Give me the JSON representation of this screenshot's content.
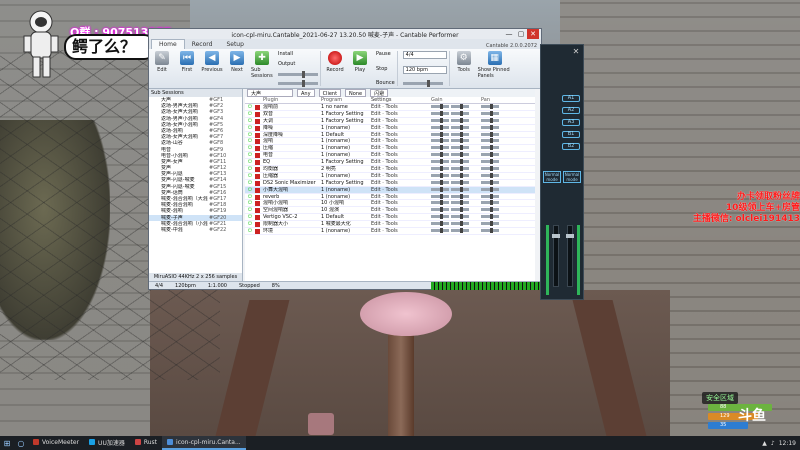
{
  "overlay": {
    "qq_label": "Q群 : 907513277",
    "bubble_text": "鳄了么？",
    "promo_lines": [
      "办卡领取粉丝牌",
      "10级领上车+房管",
      "主播微信: olclei191413"
    ],
    "safe_zone": "安全区域",
    "hp_values": [
      "88",
      "129",
      "35"
    ],
    "stream_logo": "斗鱼"
  },
  "window": {
    "title": "icon-cpl-miru.Cantable_2021-06-27 13.20.50 喊麦-子声 - Cantable Performer",
    "version": "Cantable 2.0.0.2072",
    "controls": {
      "min": "—",
      "max": "▢",
      "close": "✕"
    }
  },
  "ribbon": {
    "tabs": [
      "Home",
      "Record",
      "Setup"
    ],
    "buttons": [
      {
        "label": "Edit",
        "icon": "edit-icon"
      },
      {
        "label": "First",
        "icon": "first-icon"
      },
      {
        "label": "Previous",
        "icon": "previous-icon"
      },
      {
        "label": "Next",
        "icon": "next-icon"
      },
      {
        "label": "Sub Sessions",
        "icon": "sub-sessions-icon"
      }
    ],
    "record_label": "Record",
    "play_label": "Play",
    "options": [
      "Install",
      "Output",
      "Pause",
      "Stop",
      "Bounce"
    ],
    "tempo": "120 bpm",
    "bars": "4/4",
    "tools_label": "Tools",
    "show_panel_label": "Show Pinned Panels"
  },
  "browser": {
    "header": "Sub Sessions",
    "items": [
      {
        "name": "大声",
        "key": "#GF1"
      },
      {
        "name": "返场-男声大混响",
        "key": "#GF2"
      },
      {
        "name": "返场-女声大混响",
        "key": "#GF3"
      },
      {
        "name": "返场-男声小混响",
        "key": "#GF4"
      },
      {
        "name": "返场-女声小混响",
        "key": "#GF5"
      },
      {
        "name": "返场-混响",
        "key": "#GF6"
      },
      {
        "name": "返场-女声大混响",
        "key": "#GF7"
      },
      {
        "name": "返场-山谷",
        "key": "#GF8"
      },
      {
        "name": "电音",
        "key": "#GF9"
      },
      {
        "name": "电音-小混响",
        "key": "#GF10"
      },
      {
        "name": "变声-女声",
        "key": "#GF11"
      },
      {
        "name": "变声",
        "key": "#GF12"
      },
      {
        "name": "变声-闪退",
        "key": "#GF13"
      },
      {
        "name": "变声-闪退-喊麦",
        "key": "#GF14"
      },
      {
        "name": "变声-闪退-喊麦",
        "key": "#GF15"
      },
      {
        "name": "变声-话筒",
        "key": "#GF16"
      },
      {
        "name": "喊麦-混合混响（大混",
        "key": "#GF17"
      },
      {
        "name": "喊麦-混合混响",
        "key": "#GF18"
      },
      {
        "name": "喊麦-混响",
        "key": "#GF19"
      },
      {
        "name": "喊麦-子声",
        "key": "#GF20"
      },
      {
        "name": "喊麦-混合混响（小混",
        "key": "#GF21"
      },
      {
        "name": "喊麦-中混",
        "key": "#GF22"
      }
    ],
    "selected_index": 19,
    "footer": "MiruASIO 44KHz 2 x 256 samples"
  },
  "rack": {
    "filter": {
      "search": "大声",
      "any": "Any",
      "client": "Client",
      "none": "None",
      "channel": "闪避"
    },
    "columns": [
      "Plugin",
      "Program",
      "Settings",
      "Gain",
      "Pan"
    ],
    "rows": [
      {
        "plugin": "混响前",
        "program": "1 no name"
      },
      {
        "plugin": "双音",
        "program": "1 Factory Setting"
      },
      {
        "plugin": "大调",
        "program": "1 Factory Setting"
      },
      {
        "plugin": "降噪",
        "program": "1 (noname)"
      },
      {
        "plugin": "深度降噪",
        "program": "1 Default"
      },
      {
        "plugin": "混响",
        "program": "1 (noname)"
      },
      {
        "plugin": "压缩",
        "program": "1 (noname)"
      },
      {
        "plugin": "电音",
        "program": "1 (noname)"
      },
      {
        "plugin": "EQ",
        "program": "1 Factory Setting"
      },
      {
        "plugin": "均衡器",
        "program": "2 明亮"
      },
      {
        "plugin": "压缩器",
        "program": "1 (noname)"
      },
      {
        "plugin": "DS2 Sonic Maximizer",
        "program": "1 Factory Setting"
      },
      {
        "plugin": "小舞大混响",
        "program": "1 (noname)"
      },
      {
        "plugin": "reverb",
        "program": "1 (noname)"
      },
      {
        "plugin": "混响小混响",
        "program": "10 小混响"
      },
      {
        "plugin": "空间混响器",
        "program": "10 混演"
      },
      {
        "plugin": "Vertigo VSC-2",
        "program": "1 Default"
      },
      {
        "plugin": "限制器大小",
        "program": "1 喊麦最大化"
      },
      {
        "plugin": "环境",
        "program": "1 (noname)"
      }
    ],
    "selected_index": 12,
    "settings_label": "Edit",
    "tools_label": "Tools"
  },
  "status": {
    "time_sig": "4/4",
    "tempo": "120bpm",
    "position": "1:1.000",
    "state": "Stopped",
    "load": "8%"
  },
  "mixer": {
    "buttons": [
      "A1",
      "A2",
      "A3",
      "B1",
      "B2"
    ],
    "mode_labels": [
      "Normal mode",
      "Normal mode"
    ]
  },
  "taskbar": {
    "items": [
      {
        "label": "VoiceMeeter",
        "color": "#c0392b"
      },
      {
        "label": "UU加速器",
        "color": "#1aa1e6"
      },
      {
        "label": "Rust",
        "color": "#c44"
      },
      {
        "label": "icon-cpl-miru.Canta...",
        "color": "#4d8ed8",
        "active": true
      }
    ],
    "clock": "12:19"
  }
}
